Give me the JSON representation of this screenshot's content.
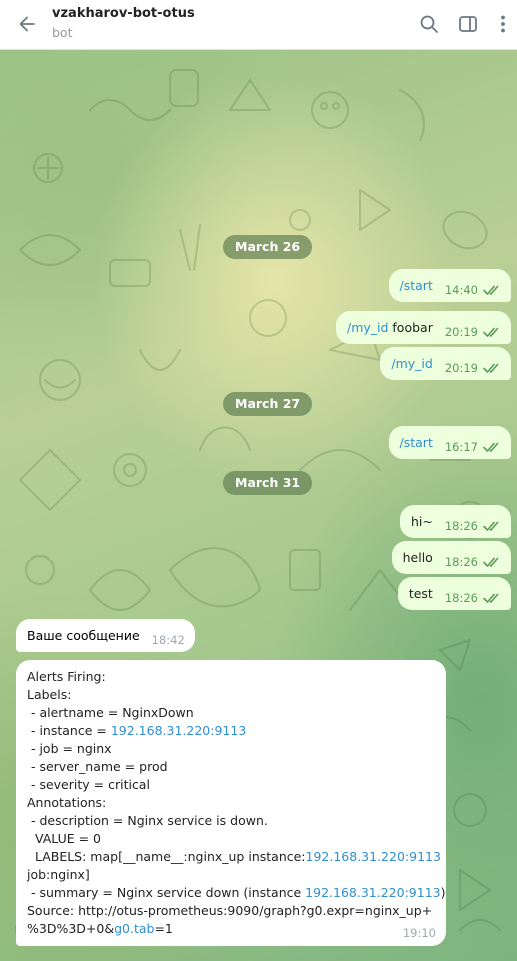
{
  "header": {
    "title": "vzakharov-bot-otus",
    "subtitle": "bot"
  },
  "dates": [
    "March 26",
    "March 27",
    "March 31"
  ],
  "messages_out": [
    {
      "cmd": "/start",
      "text": "",
      "time": "14:40"
    },
    {
      "cmd": "/my_id",
      "text": " foobar",
      "time": "20:19"
    },
    {
      "cmd": "/my_id",
      "text": "",
      "time": "20:19"
    },
    {
      "cmd": "/start",
      "text": "",
      "time": "16:17"
    },
    {
      "cmd": "",
      "text": "hi~",
      "time": "18:26"
    },
    {
      "cmd": "",
      "text": "hello",
      "time": "18:26"
    },
    {
      "cmd": "",
      "text": "test",
      "time": "18:26"
    }
  ],
  "message_in_1": {
    "text": "Ваше сообщение",
    "time": "18:42"
  },
  "alert": {
    "time": "19:10",
    "lines": [
      {
        "a": "Alerts Firing:",
        "link": "",
        "b": ""
      },
      {
        "a": "Labels:",
        "link": "",
        "b": ""
      },
      {
        "a": " - alertname = NginxDown",
        "link": "",
        "b": ""
      },
      {
        "a": " - instance = ",
        "link": "192.168.31.220:9113",
        "b": ""
      },
      {
        "a": " - job = nginx",
        "link": "",
        "b": ""
      },
      {
        "a": " - server_name = prod",
        "link": "",
        "b": ""
      },
      {
        "a": " - severity = critical",
        "link": "",
        "b": ""
      },
      {
        "a": "Annotations:",
        "link": "",
        "b": ""
      },
      {
        "a": " - description = Nginx service is down.",
        "link": "",
        "b": ""
      },
      {
        "a": "  VALUE = 0",
        "link": "",
        "b": ""
      },
      {
        "a": "  LABELS: map[__name__:nginx_up instance:",
        "link": "192.168.31.220:9113",
        "b": ""
      },
      {
        "a": "job:nginx]",
        "link": "",
        "b": ""
      },
      {
        "a": " - summary = Nginx service down (instance ",
        "link": "192.168.31.220:9113",
        "b": ")"
      },
      {
        "a": "Source: http://otus-prometheus:9090/graph?g0.expr=nginx_up+",
        "link": "",
        "b": ""
      },
      {
        "a": "%3D%3D+0&",
        "link": "g0.tab",
        "b": "=1"
      }
    ]
  },
  "colors": {
    "bubble_out": "#eeffde",
    "bubble_in": "#ffffff",
    "link": "#2f8fd0",
    "time_out": "#5a9b58",
    "date_pill": "#64805a"
  }
}
